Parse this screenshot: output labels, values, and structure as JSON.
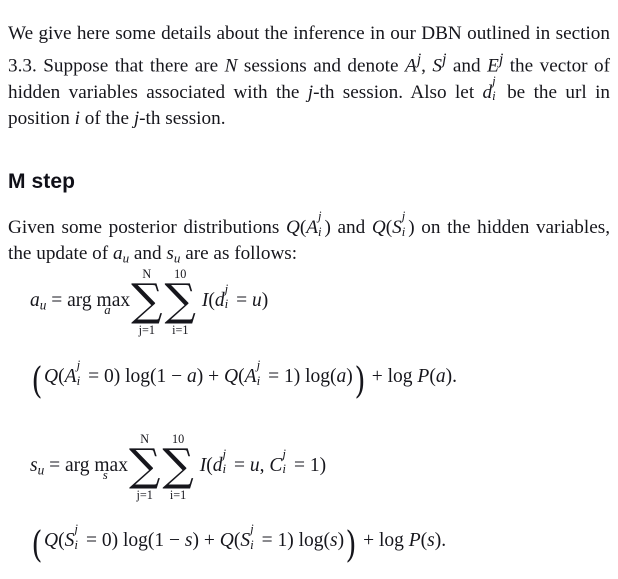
{
  "document": {
    "background_color": "#ffffff",
    "text_color": "#16161c"
  },
  "paragraphs": {
    "intro": "We give here some details about the inference in our DBN outlined in section 3.3. Suppose that there are N sessions and denote Aʲ, Sʲ and Eʲ the vector of hidden variables associated with the j-th session. Also let dᵢʲ be the url in position i of the j-th session.",
    "posterior": "Given some posterior distributions Q(Aᵢʲ) and Q(Sᵢʲ) on the hidden variables, the update of aᵤ and sᵤ are as follows:"
  },
  "heading": {
    "m_step": "M step"
  },
  "intro_runs": {
    "t1": "We give here some details about the inference in our DBN outlined in section 3.3. Suppose that there are ",
    "v_N": "N",
    "t2": " sessions and denote ",
    "v_A": "A",
    "sup_j1": "j",
    "t3": ", ",
    "v_S": "S",
    "sup_j2": "j",
    "t4": " and ",
    "v_E": "E",
    "sup_j3": "j",
    "t5": " the vector of hidden variables associated with the ",
    "v_j": "j",
    "t6": "-th session. Also let ",
    "v_d": "d",
    "d_sup": "j",
    "d_sub": "i",
    "t7": " be the url in position ",
    "v_i": "i",
    "t8": " of the ",
    "v_j2": "j",
    "t9": "-th session."
  },
  "posterior_runs": {
    "t1": "Given some posterior distributions ",
    "q1": "Q",
    "q1_open": "(",
    "q1_var": "A",
    "q1_sup": "j",
    "q1_sub": "i",
    "q1_close": ")",
    "t2": " and ",
    "q2": "Q",
    "q2_open": "(",
    "q2_var": "S",
    "q2_sup": "j",
    "q2_sub": "i",
    "q2_close": ")",
    "t3": " on the hidden variables, the update of ",
    "a_var": "a",
    "a_sub": "u",
    "t4": " and ",
    "s_var": "s",
    "s_sub": "u",
    "t5": " are as follows:"
  },
  "equation_a": {
    "lhs_var": "a",
    "lhs_sub": "u",
    "equals": "=",
    "argmax": "arg max",
    "argmax_sub": "a",
    "sum1_glyph": "∑",
    "sum1_top": "N",
    "sum1_bot": "j=1",
    "sum2_glyph": "∑",
    "sum2_top": "10",
    "sum2_bot": "i=1",
    "indicator": "I",
    "open_paren": "(",
    "d_var": "d",
    "d_sup": "j",
    "d_sub": "i",
    "eq_sign": "=",
    "u_var": "u",
    "close_paren": ")"
  },
  "equation_a_line2": {
    "lparen": "(",
    "q": "Q",
    "q_open": "(",
    "q_var": "A",
    "q_sup": "j",
    "q_sub": "i",
    "q_eq": "=",
    "q_val0": "0",
    "q_close": ")",
    "log1": "log",
    "log1_open": "(",
    "one": "1",
    "minus": "−",
    "a_var": "a",
    "log1_close": ")",
    "plus1": "+",
    "q2": "Q",
    "q2_open": "(",
    "q2_var": "A",
    "q2_sup": "j",
    "q2_sub": "i",
    "q2_eq": "=",
    "q2_val1": "1",
    "q2_close": ")",
    "log2": "log",
    "log2_open": "(",
    "log2_var": "a",
    "log2_close": ")",
    "rparen": ")",
    "plus2": "+",
    "log3": "log",
    "p": "P",
    "p_open": "(",
    "p_var": "a",
    "p_close": ")",
    "period": "."
  },
  "equation_s": {
    "lhs_var": "s",
    "lhs_sub": "u",
    "equals": "=",
    "argmax": "arg max",
    "argmax_sub": "s",
    "sum1_glyph": "∑",
    "sum1_top": "N",
    "sum1_bot": "j=1",
    "sum2_glyph": "∑",
    "sum2_top": "10",
    "sum2_bot": "i=1",
    "indicator": "I",
    "open_paren": "(",
    "d_var": "d",
    "d_sup": "j",
    "d_sub": "i",
    "eq_sign": "=",
    "u_var": "u",
    "comma": ",",
    "c_var": "C",
    "c_sup": "j",
    "c_sub": "i",
    "c_eq": "=",
    "c_val": "1",
    "close_paren": ")"
  },
  "equation_s_line2": {
    "lparen": "(",
    "q": "Q",
    "q_open": "(",
    "q_var": "S",
    "q_sup": "j",
    "q_sub": "i",
    "q_eq": "=",
    "q_val0": "0",
    "q_close": ")",
    "log1": "log",
    "log1_open": "(",
    "one": "1",
    "minus": "−",
    "s_var": "s",
    "log1_close": ")",
    "plus1": "+",
    "q2": "Q",
    "q2_open": "(",
    "q2_var": "S",
    "q2_sup": "j",
    "q2_sub": "i",
    "q2_eq": "=",
    "q2_val1": "1",
    "q2_close": ")",
    "log2": "log",
    "log2_open": "(",
    "log2_var": "s",
    "log2_close": ")",
    "rparen": ")",
    "plus2": "+",
    "log3": "log",
    "p": "P",
    "p_open": "(",
    "p_var": "s",
    "p_close": ")",
    "period": "."
  }
}
